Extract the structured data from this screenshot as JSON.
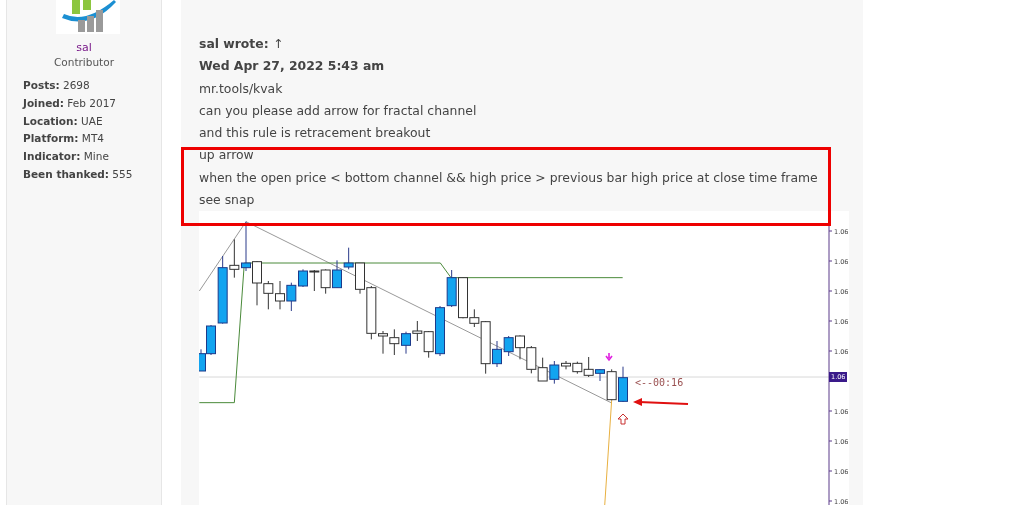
{
  "profile": {
    "username": "sal",
    "rank": "Contributor",
    "stats": [
      {
        "label": "Posts:",
        "value": "2698"
      },
      {
        "label": "Joined:",
        "value": "Feb 2017"
      },
      {
        "label": "Location:",
        "value": "UAE"
      },
      {
        "label": "Platform:",
        "value": "MT4"
      },
      {
        "label": "Indicator:",
        "value": "Mine"
      },
      {
        "label": "Been thanked:",
        "value": "555"
      }
    ]
  },
  "post": {
    "quote_author": "sal wrote:",
    "quote_link": "↑",
    "quote_date": "Wed Apr 27, 2022 5:43 am",
    "lines": [
      "mr.tools/kvak",
      "can you please add arrow for fractal channel",
      "and this rule is retracement breakout",
      "up arrow",
      "when the open price < bottom channel && high price > previous bar high price at close time frame",
      "see snap"
    ],
    "snap": {
      "timer": "<--00:16",
      "current_price": "1.06",
      "axis_labels": [
        "1.06",
        "1.06",
        "1.06",
        "1.06",
        "1.06",
        "1.06",
        "1.06",
        "1.06",
        "1.06"
      ]
    }
  }
}
